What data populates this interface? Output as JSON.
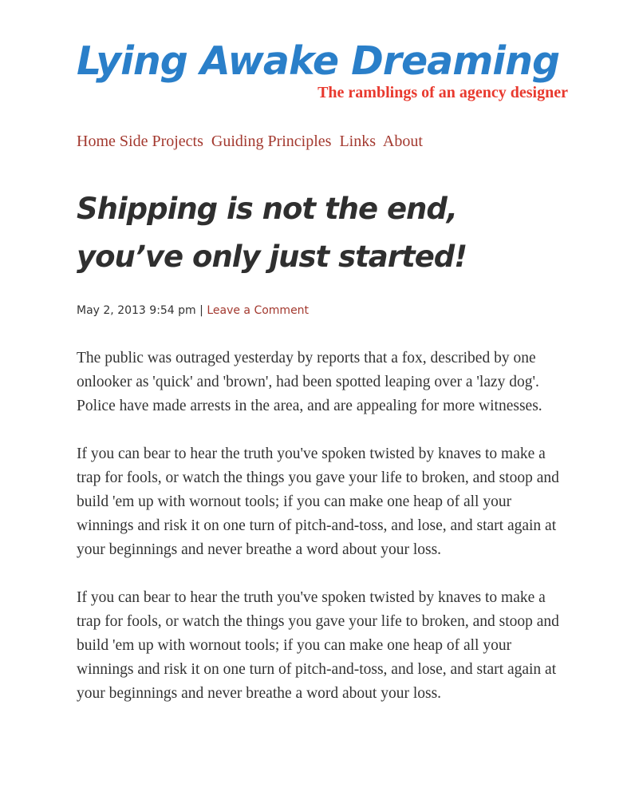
{
  "header": {
    "site_title": "Lying Awake Dreaming",
    "tagline": "The ramblings of an agency designer"
  },
  "nav": {
    "items": [
      "Home",
      "Side Projects",
      "Guiding Principles",
      "Links",
      "About"
    ]
  },
  "post": {
    "title_line1": "Shipping is not the end,",
    "title_line2": "you’ve only just started!",
    "date": "May 2, 2013 9:54 pm",
    "separator": "|",
    "comment_link": "Leave a Comment",
    "paragraphs": [
      "The public was outraged yesterday by reports that a fox, described by one onlooker as 'quick' and 'brown', had been spotted leaping over a 'lazy dog'. Police have made arrests in the area, and are appealing for more witnesses.",
      "If you can bear to hear the truth you've spoken twisted by knaves to make a trap for fools, or watch the things you gave your life to broken, and stoop and build 'em up with wornout tools; if you can make one heap of all your winnings and risk it on one turn of pitch-and-toss, and lose, and start again at your beginnings and never breathe a word about your loss.",
      "If you can bear to hear the truth you've spoken twisted by knaves to make a trap for fools, or watch the things you gave your life to broken, and stoop and build 'em up with wornout tools; if you can make one heap of all your winnings and risk it on one turn of pitch-and-toss, and lose, and start again at your beginnings and never breathe a word about your loss."
    ]
  }
}
